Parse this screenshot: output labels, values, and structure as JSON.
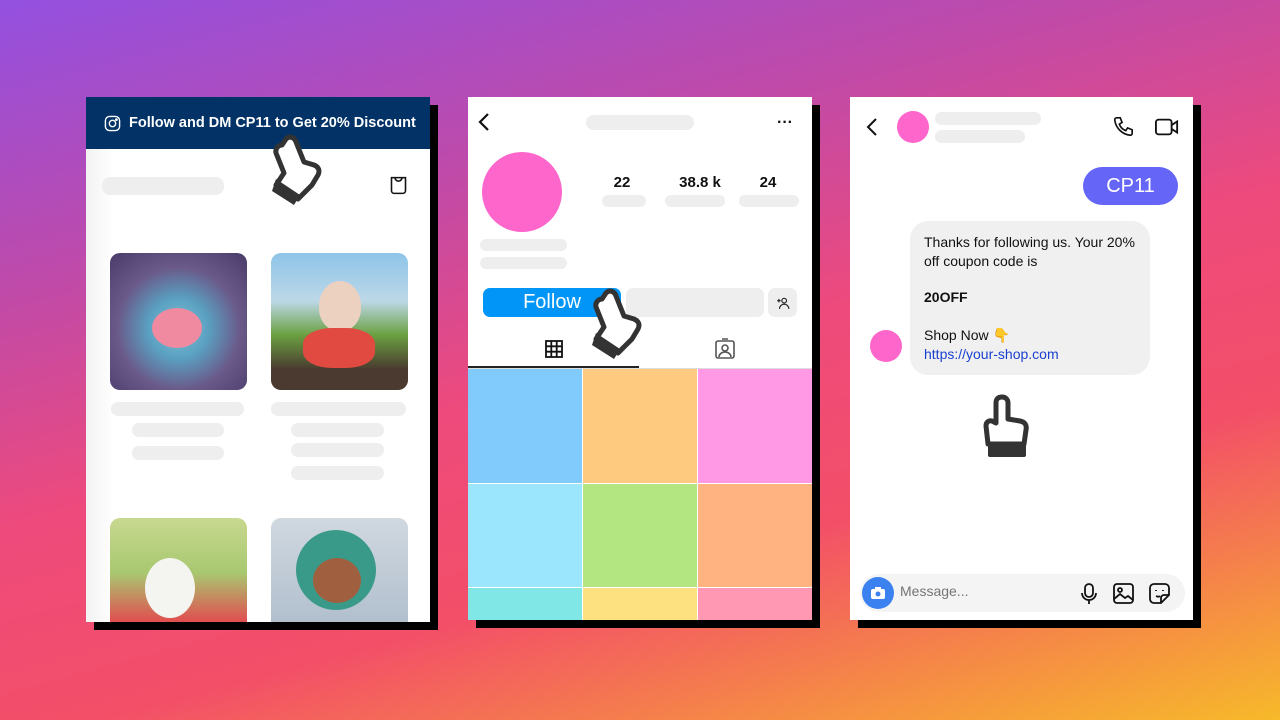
{
  "store_panel": {
    "banner_text": "Follow and DM CP11 to Get 20% Discount",
    "banner_icon": "instagram-icon",
    "cart_icon": "shopping-bag-icon",
    "banner_color": "#033366"
  },
  "profile_panel": {
    "stats": [
      "22",
      "38.8 k",
      "24"
    ],
    "follow_label": "Follow",
    "follow_color": "#0095f6",
    "avatar_color": "#ff66cc",
    "grid_colors": [
      "#80cbfc",
      "#fdca80",
      "#ff99e6",
      "#9ce6fd",
      "#b3e680",
      "#ffb380",
      "#80e6e6",
      "#fde080",
      "#ff99b3"
    ]
  },
  "dm_panel": {
    "sent_message": "CP11",
    "received_lines": [
      "Thanks for following us. Your 20% off coupon code is",
      "20OFF",
      "Shop Now 👇",
      "https://your-shop.com"
    ],
    "message_placeholder": "Message...",
    "sent_color": "#6565f7"
  }
}
